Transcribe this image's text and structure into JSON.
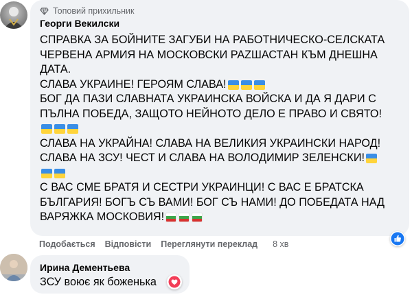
{
  "comment1": {
    "badge": "Топовий прихильник",
    "author": "Георги Векилски",
    "lines": [
      {
        "text": "СПРАВКА ЗА БОЙНИТЕ ЗАГУБИ НА РАБОТНИЧЕСКО-СЕЛСКАТА",
        "flags": []
      },
      {
        "text": "ЧЕРВЕНА АРМИЯ НА МОСКОВСКИ PAZШАСТАН КЪМ ДНЕШНА",
        "flags": []
      },
      {
        "text": "ДАТА.",
        "flags": []
      },
      {
        "text": "СЛАВА УКРАИНЕ! ГЕРОЯМ СЛАВА!",
        "flags": [
          "ua",
          "ua",
          "ua"
        ]
      },
      {
        "text": "БОГ ДА ПАЗИ СЛАВНАТА УКРАИНСКА ВОЙСКА И ДА Я ДАРИ С",
        "flags": []
      },
      {
        "text": "ПЪЛНА ПОБЕДА, ЗАЩОТО НЕЙНОТО ДЕЛО Е ПРАВО И СВЯТО!",
        "flags": []
      },
      {
        "text": "",
        "flags": [
          "ua",
          "ua",
          "ua"
        ]
      },
      {
        "text": "СЛАВА НА УКРАЙНА! СЛАВА НА ВЕЛИКИЯ УКРАИНСКИ НАРОД!",
        "flags": []
      },
      {
        "text": "СЛАВА НА ЗСУ! ЧЕСТ И СЛАВА НА ВОЛОДИМИР ЗЕЛЕНСКИ!",
        "flags": [
          "ua"
        ]
      },
      {
        "text": "",
        "flags": [
          "ua",
          "ua"
        ]
      },
      {
        "text": "С ВАС СМЕ БРАТЯ И СЕСТРИ УКРАИНЦИ! С ВАС Е БРАТСКА",
        "flags": []
      },
      {
        "text": "БЪЛГАРИЯ! БОГЪ СЪ ВАМИ! БОГ СЪ НАМИ! ДО ПОБЕДАТА НАД",
        "flags": []
      },
      {
        "text": "ВАРЯЖКА МОСКОВИЯ!",
        "flags": [
          "bg",
          "bg",
          "bg"
        ]
      }
    ]
  },
  "actions": {
    "like": "Подобається",
    "reply": "Відповісти",
    "translate": "Переглянути переклад",
    "time": "8 хв"
  },
  "comment2": {
    "author": "Ирина Дементьева",
    "text": "ЗСУ воює як боженька"
  },
  "reactions": {
    "comment1": "like-icon",
    "comment2": "love-icon"
  },
  "colors": {
    "bubble": "#f0f2f5",
    "secondary_text": "#65676b",
    "like_blue": "#1877f2",
    "love_red": "#f33e58",
    "flag_ua_blue": "#3a8ee6",
    "flag_ua_yellow": "#ffd43b"
  }
}
